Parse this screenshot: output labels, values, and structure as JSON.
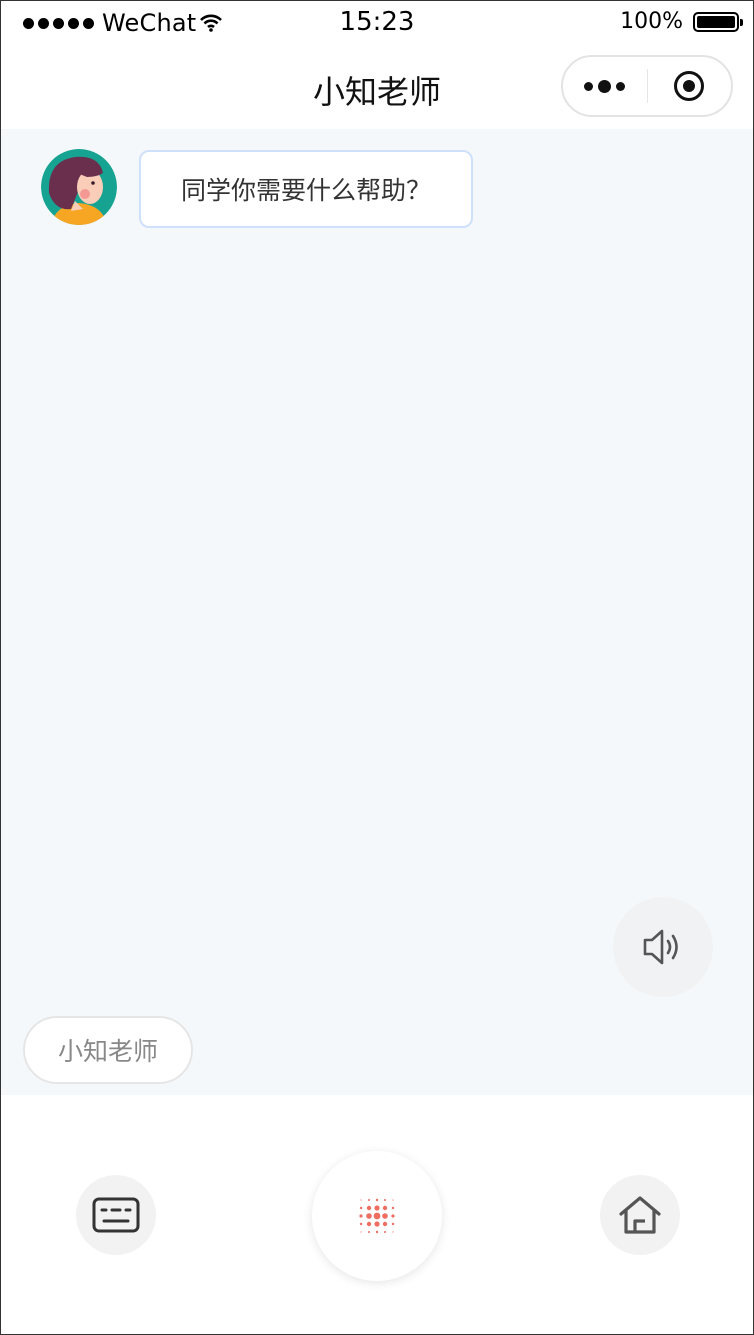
{
  "status_bar": {
    "carrier": "WeChat",
    "time": "15:23",
    "battery_text": "100%",
    "battery_level": 1.0,
    "signal_icon": "signal-dots-icon",
    "wifi_icon": "wifi-icon"
  },
  "nav": {
    "title": "小知老师",
    "more_icon": "more-dots-icon",
    "close_icon": "target-close-icon"
  },
  "chat": {
    "messages": [
      {
        "sender": "assistant",
        "avatar_icon": "teacher-avatar",
        "text": "同学你需要什么帮助？"
      }
    ],
    "speaker_icon": "speaker-icon",
    "assistant_chip": "小知老师"
  },
  "bottom_bar": {
    "keyboard_icon": "keyboard-icon",
    "voice_icon": "voice-dots-icon",
    "home_icon": "home-icon",
    "voice_color": "#ef6e62"
  },
  "colors": {
    "chat_background": "#f5f8fa",
    "bubble_border": "#cfe0fb",
    "chip_text": "#888888"
  }
}
